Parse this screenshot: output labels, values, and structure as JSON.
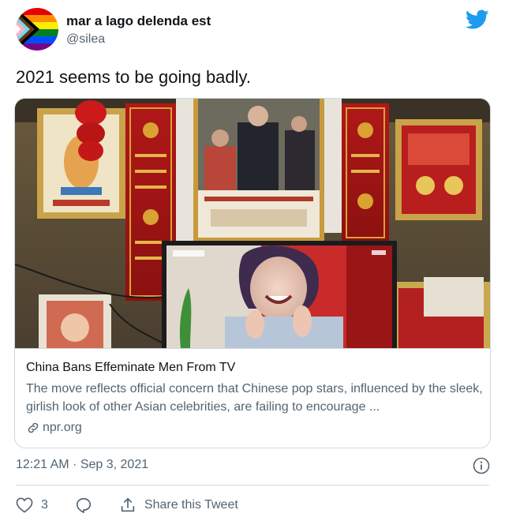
{
  "author": {
    "display_name": "mar a lago delenda est",
    "handle": "@silea",
    "avatar_icon": "pride-progress-flag-avatar"
  },
  "brand_icon": "twitter-bird-icon",
  "tweet": {
    "text": "2021 seems to be going badly."
  },
  "card": {
    "title": "China Bans Effeminate Men From TV",
    "description": "The move reflects official concern that Chinese pop stars, influenced by the sleek, girlish look of other Asian celebrities, are failing to encourage ...",
    "domain": "npr.org",
    "image_alt": "Photo of a TV screen showing a laughing pop star in front of framed portraits and Tibetan wall hangings"
  },
  "meta": {
    "timestamp": "12:21 AM · Sep 3, 2021"
  },
  "actions": {
    "like_count": "3",
    "share_label": "Share this Tweet"
  },
  "colors": {
    "brand": "#1d9bf0",
    "text": "#0f1419",
    "secondary": "#536471",
    "border": "#cfd9de"
  }
}
